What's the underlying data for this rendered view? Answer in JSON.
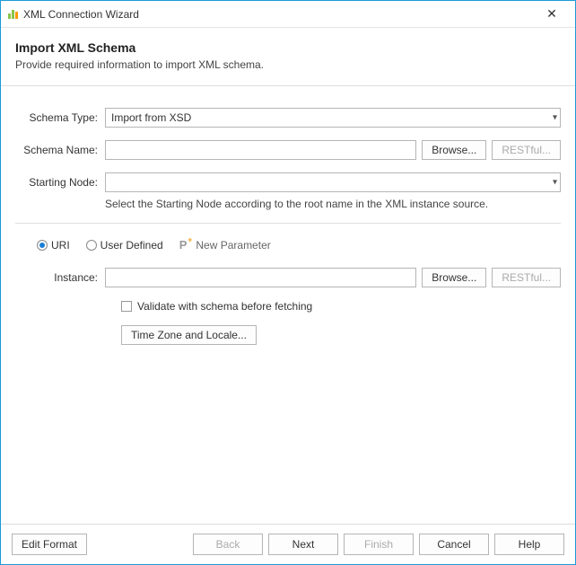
{
  "window": {
    "title": "XML Connection Wizard"
  },
  "header": {
    "title": "Import XML Schema",
    "subtitle": "Provide required information to import XML schema."
  },
  "fields": {
    "schemaType": {
      "label": "Schema Type:",
      "value": "Import from XSD"
    },
    "schemaName": {
      "label": "Schema Name:",
      "value": "",
      "browse": "Browse...",
      "restful": "RESTful..."
    },
    "startingNode": {
      "label": "Starting Node:",
      "value": "",
      "hint": "Select the Starting Node according to the root name in the XML instance source."
    },
    "instance": {
      "label": "Instance:",
      "value": "",
      "browse": "Browse...",
      "restful": "RESTful..."
    }
  },
  "radios": {
    "uri": "URI",
    "userDefined": "User Defined",
    "newParam": "New Parameter",
    "selected": "uri"
  },
  "options": {
    "validate": "Validate with schema before fetching",
    "timezone": "Time Zone and Locale..."
  },
  "footer": {
    "editFormat": "Edit Format",
    "back": "Back",
    "next": "Next",
    "finish": "Finish",
    "cancel": "Cancel",
    "help": "Help"
  }
}
